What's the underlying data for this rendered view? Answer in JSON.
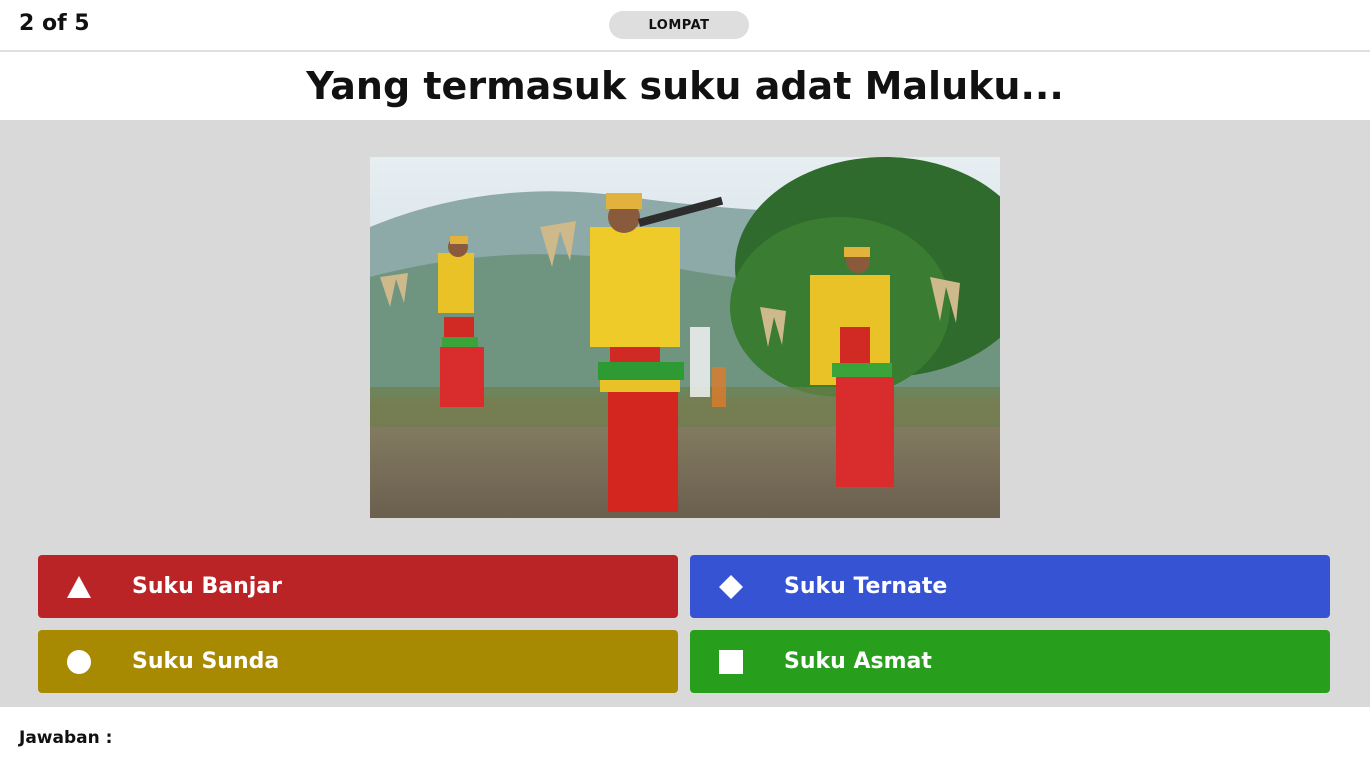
{
  "header": {
    "progress": "2 of 5",
    "skip_label": "LOMPAT"
  },
  "question": {
    "text": "Yang termasuk suku adat Maluku..."
  },
  "answers": [
    {
      "shape": "triangle-icon",
      "label": "Suku Banjar",
      "color": "#bb2427"
    },
    {
      "shape": "diamond-icon",
      "label": "Suku Ternate",
      "color": "#3653d4"
    },
    {
      "shape": "circle-icon",
      "label": "Suku Sunda",
      "color": "#a78a02"
    },
    {
      "shape": "square-icon",
      "label": "Suku Asmat",
      "color": "#279e1c"
    }
  ],
  "footer": {
    "answer_label": "Jawaban :"
  }
}
